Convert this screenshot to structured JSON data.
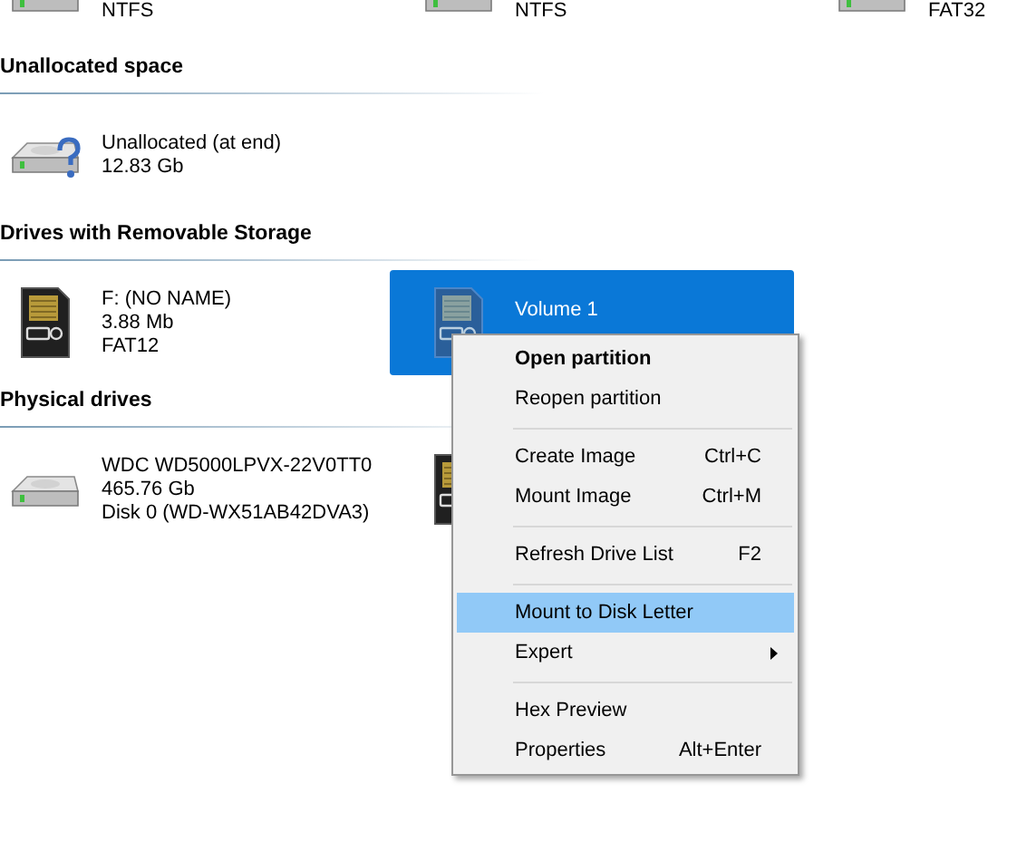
{
  "top_row": [
    {
      "kind": "hdd",
      "lines": [
        "NTFS"
      ]
    },
    {
      "kind": "hdd",
      "lines": [
        "NTFS"
      ]
    },
    {
      "kind": "hdd",
      "lines": [
        "FAT32"
      ]
    }
  ],
  "sections": [
    {
      "title": "Unallocated space",
      "items": [
        {
          "kind": "unallocated",
          "lines": [
            "Unallocated (at end)",
            "12.83 Gb"
          ],
          "selected": false
        }
      ]
    },
    {
      "title": "Drives with Removable Storage",
      "items": [
        {
          "kind": "card",
          "lines": [
            "F: (NO NAME)",
            "3.88 Mb",
            "FAT12"
          ],
          "selected": false
        },
        {
          "kind": "card",
          "lines": [
            "Volume 1"
          ],
          "selected": true
        }
      ]
    },
    {
      "title": "Physical drives",
      "items": [
        {
          "kind": "hdd",
          "lines": [
            "WDC WD5000LPVX-22V0TT0",
            "465.76 Gb",
            "Disk 0 (WD-WX51AB42DVA3)"
          ],
          "selected": false
        },
        {
          "kind": "card",
          "selected": false
        }
      ]
    }
  ],
  "context_menu": [
    {
      "kind": "item",
      "label": "Open partition",
      "default": true,
      "selected": false
    },
    {
      "kind": "item",
      "label": "Reopen partition",
      "default": false,
      "selected": false
    },
    {
      "kind": "separator"
    },
    {
      "kind": "item",
      "label": "Create Image",
      "shortcut": "Ctrl+C",
      "default": false,
      "selected": false
    },
    {
      "kind": "item",
      "label": "Mount Image",
      "shortcut": "Ctrl+M",
      "default": false,
      "selected": false
    },
    {
      "kind": "separator"
    },
    {
      "kind": "item",
      "label": "Refresh Drive List",
      "shortcut": "F2",
      "default": false,
      "selected": false
    },
    {
      "kind": "separator"
    },
    {
      "kind": "item",
      "label": "Mount to Disk Letter",
      "default": false,
      "selected": true
    },
    {
      "kind": "submenu",
      "label": "Expert",
      "default": false,
      "selected": false
    },
    {
      "kind": "separator"
    },
    {
      "kind": "item",
      "label": "Hex Preview",
      "default": false,
      "selected": false
    },
    {
      "kind": "item",
      "label": "Properties",
      "shortcut": "Alt+Enter",
      "default": false,
      "selected": false
    }
  ]
}
